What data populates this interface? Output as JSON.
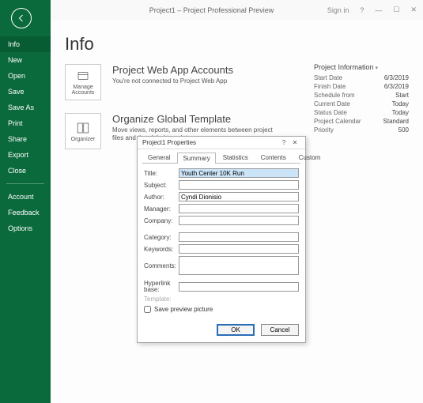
{
  "titlebar": {
    "title": "Project1 – Project Professional Preview",
    "signin": "Sign in",
    "help": "?",
    "min": "—",
    "max": "☐",
    "close": "✕"
  },
  "sidebar": {
    "items": [
      "Info",
      "New",
      "Open",
      "Save",
      "Save As",
      "Print",
      "Share",
      "Export",
      "Close"
    ],
    "bottom": [
      "Account",
      "Feedback",
      "Options"
    ]
  },
  "page": {
    "title": "Info",
    "accounts": {
      "tile": "Manage Accounts",
      "heading": "Project Web App Accounts",
      "desc": "You're not connected to Project Web App"
    },
    "organizer": {
      "tile": "Organizer",
      "heading": "Organize Global Template",
      "desc": "Move views, reports, and other elements between project files and the global template."
    }
  },
  "projinfo": {
    "heading": "Project Information",
    "rows": [
      {
        "k": "Start Date",
        "v": "6/3/2019"
      },
      {
        "k": "Finish Date",
        "v": "6/3/2019"
      },
      {
        "k": "Schedule from",
        "v": "Start"
      },
      {
        "k": "Current Date",
        "v": "Today"
      },
      {
        "k": "Status Date",
        "v": "Today"
      },
      {
        "k": "Project Calendar",
        "v": "Standard"
      },
      {
        "k": "Priority",
        "v": "500"
      }
    ]
  },
  "dialog": {
    "title": "Project1 Properties",
    "tabs": [
      "General",
      "Summary",
      "Statistics",
      "Contents",
      "Custom"
    ],
    "fields": {
      "title_lbl": "Title:",
      "title_val": "Youth Center 10K Run",
      "subject_lbl": "Subject:",
      "subject_val": "",
      "author_lbl": "Author:",
      "author_val": "Cyndi Dionisio",
      "manager_lbl": "Manager:",
      "manager_val": "",
      "company_lbl": "Company:",
      "company_val": "",
      "category_lbl": "Category:",
      "category_val": "",
      "keywords_lbl": "Keywords:",
      "keywords_val": "",
      "comments_lbl": "Comments:",
      "comments_val": "",
      "hyperlink_lbl": "Hyperlink base:",
      "hyperlink_val": "",
      "template_lbl": "Template:"
    },
    "checkbox": "Save preview picture",
    "ok": "OK",
    "cancel": "Cancel"
  }
}
